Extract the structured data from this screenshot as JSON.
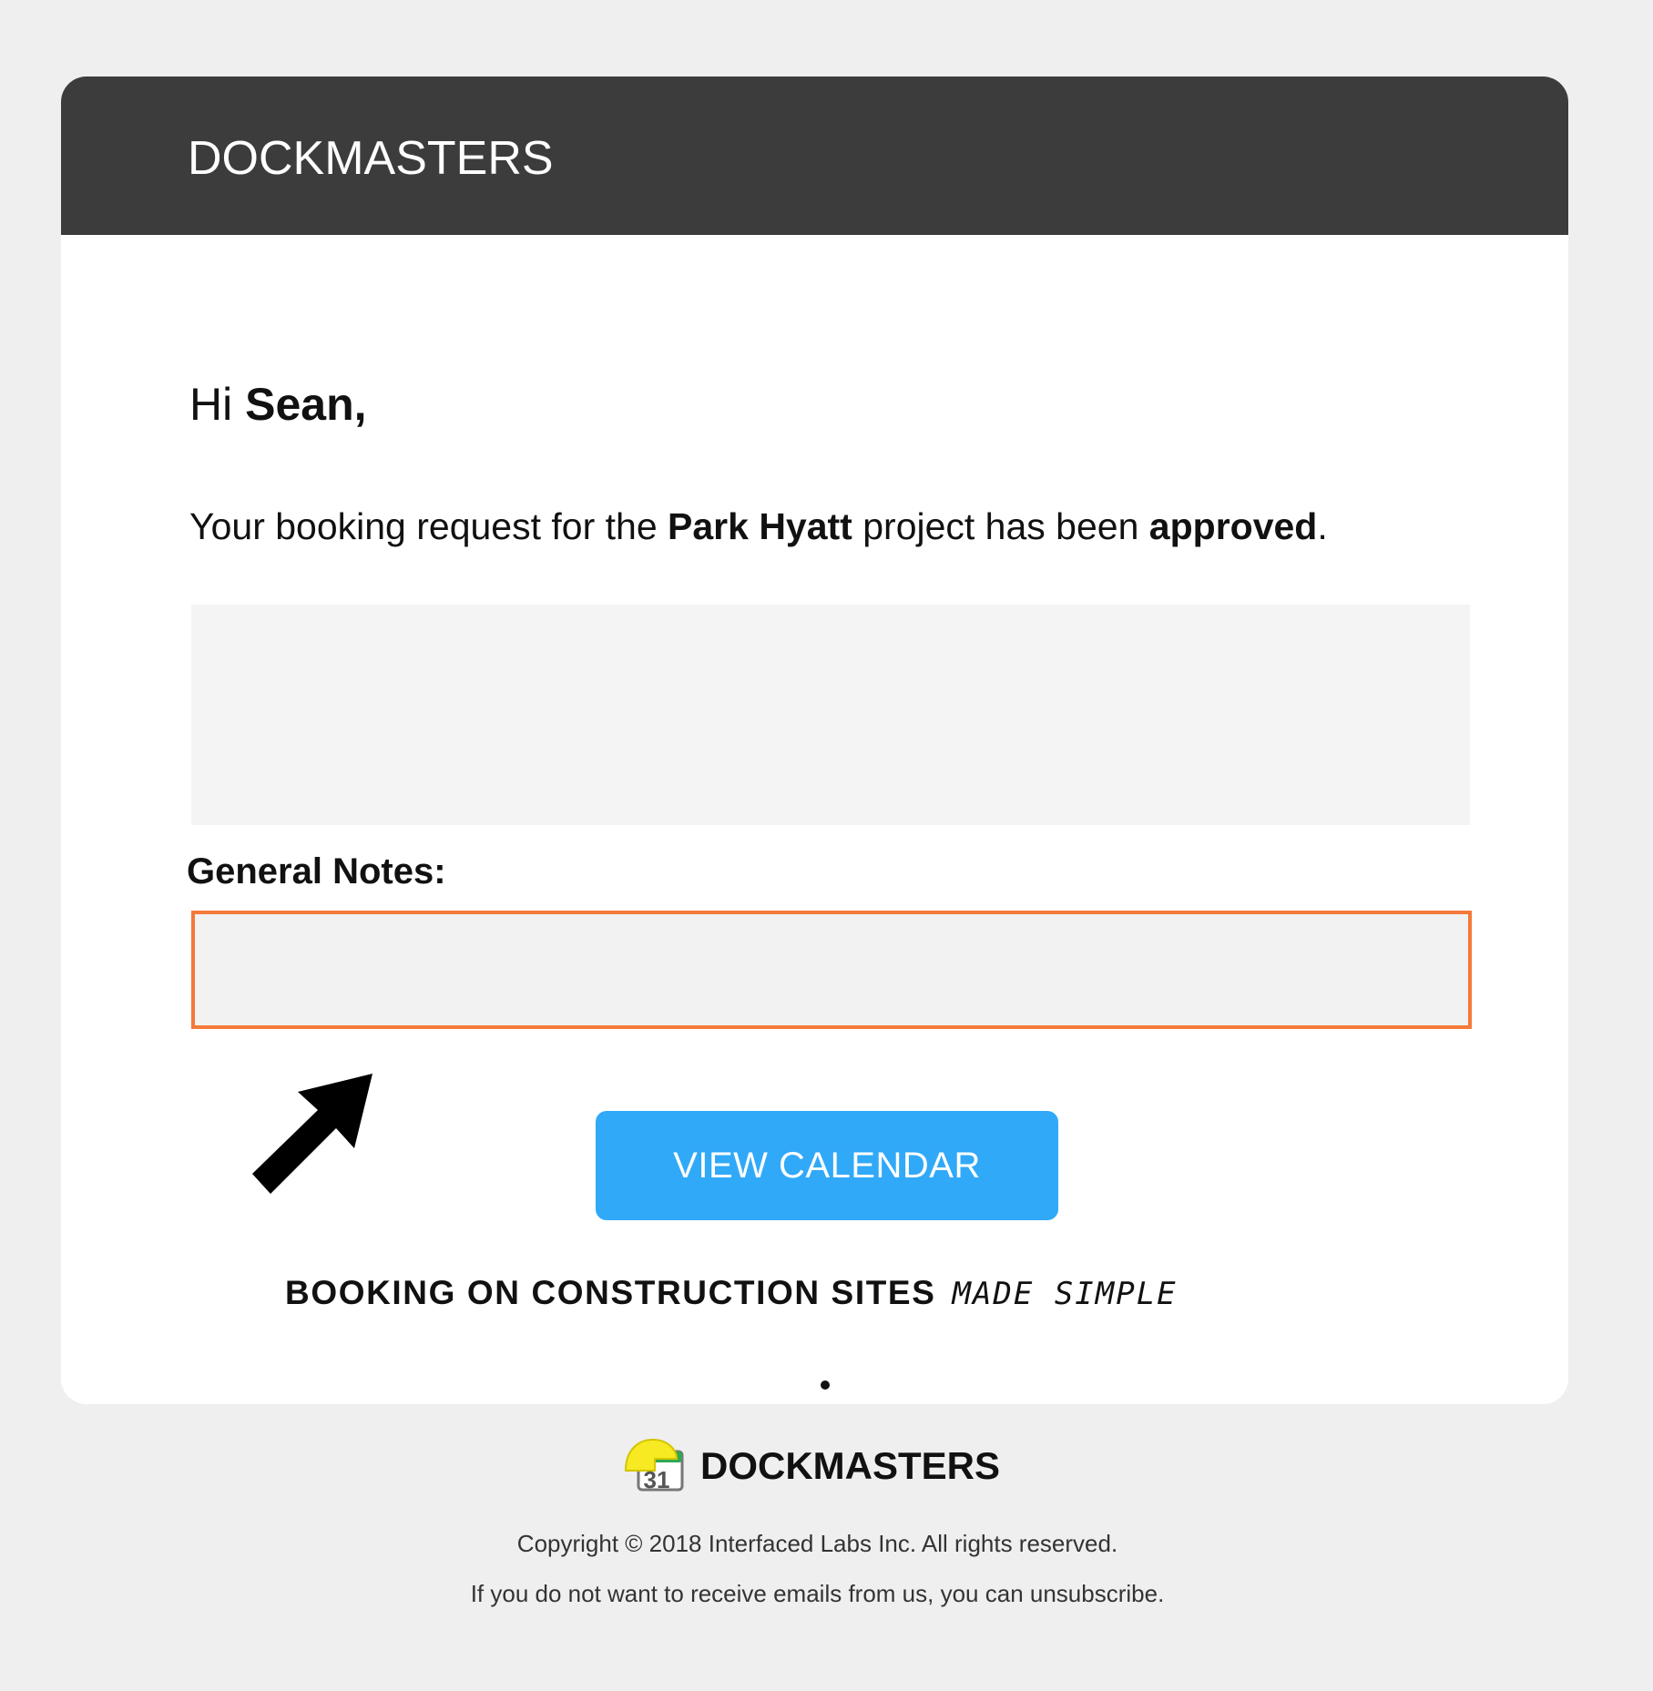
{
  "header": {
    "brand": "DOCKMASTERS"
  },
  "greeting": {
    "prefix": "Hi ",
    "name": "Sean,"
  },
  "message": {
    "part1": "Your booking request for the ",
    "project": "Park Hyatt",
    "part2": " project  has been ",
    "status": "approved",
    "part3": "."
  },
  "notes": {
    "label": "General Notes:",
    "value": ""
  },
  "button": {
    "label": "VIEW CALENDAR"
  },
  "tagline": {
    "strong": "BOOKING ON CONSTRUCTION SITES",
    "handwritten": "MADE SIMPLE"
  },
  "footer": {
    "brand": "DOCKMASTERS",
    "logo_number": "31",
    "copyright": "Copyright © 2018 Interfaced Labs Inc. All rights reserved.",
    "unsubscribe": "If you do not want to receive emails from us, you can unsubscribe."
  },
  "colors": {
    "header_background": "#3c3c3c",
    "button_background": "#30a9f8",
    "highlight_border": "#f47a3a",
    "page_background": "#efefef"
  },
  "icons": {
    "pointer": "arrow-pointer-icon",
    "logo": "calendar-hardhat-logo-icon"
  }
}
